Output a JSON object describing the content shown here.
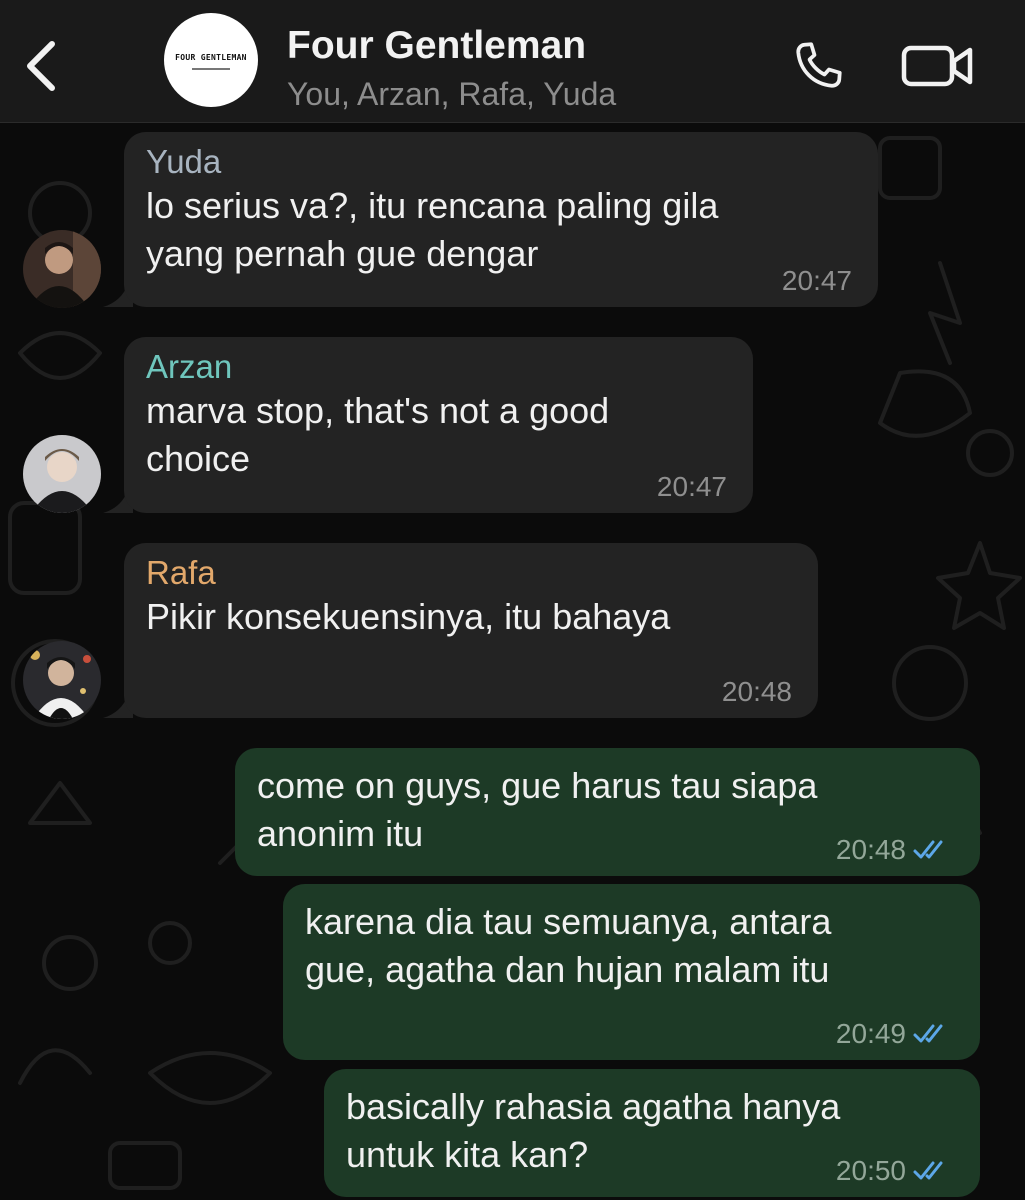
{
  "header": {
    "title": "Four Gentleman",
    "members": "You, Arzan, Rafa, Yuda",
    "avatar_logo_text": "FOUR GENTLEMAN",
    "back_icon": "chevron-left-icon",
    "call_icon": "phone-icon",
    "video_icon": "video-camera-icon"
  },
  "colors": {
    "header_bg": "#1a1a1a",
    "incoming_bubble": "#232323",
    "outgoing_bubble": "#1d3a26",
    "read_ticks": "#5ca7e8",
    "yuda_name": "#a8b4c0",
    "arzan_name": "#6fc6bd",
    "rafa_name": "#e2a86b"
  },
  "messages": [
    {
      "sender": "Yuda",
      "text": "lo serius va?, itu rencana paling gila\nyang pernah gue dengar",
      "time": "20:47",
      "direction": "in"
    },
    {
      "sender": "Arzan",
      "text": "marva stop, that's not a good\nchoice",
      "time": "20:47",
      "direction": "in"
    },
    {
      "sender": "Rafa",
      "text": "Pikir konsekuensinya, itu bahaya",
      "time": "20:48",
      "direction": "in"
    },
    {
      "sender": "You",
      "text": "come on guys, gue harus tau siapa\nanonim itu",
      "time": "20:48",
      "direction": "out",
      "status": "read"
    },
    {
      "sender": "You",
      "text": "karena dia tau semuanya, antara\ngue, agatha dan hujan malam itu",
      "time": "20:49",
      "direction": "out",
      "status": "read"
    },
    {
      "sender": "You",
      "text": "basically rahasia agatha hanya\nuntuk kita kan?",
      "time": "20:50",
      "direction": "out",
      "status": "read"
    }
  ]
}
